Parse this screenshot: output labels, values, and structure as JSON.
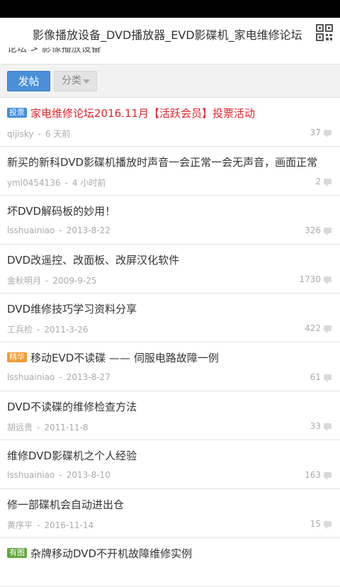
{
  "header": {
    "title": "影像播放设备_DVD播放器_EVD影碟机_家电维修论坛",
    "qr_icon": "qr-code-icon"
  },
  "breadcrumb": "论坛 > 影像播放设备",
  "toolbar": {
    "post_label": "发帖",
    "category_label": "分类"
  },
  "threads": [
    {
      "tag": "投票",
      "tag_type": "vote",
      "title": "家电维修论坛2016.11月【活跃会员】投票活动",
      "highlight": true,
      "author": "qijisky",
      "time": "6 天前",
      "replies": "37"
    },
    {
      "tag": "",
      "tag_type": "",
      "title": "新买的新科DVD影碟机播放时声音一会正常一会无声音，画面正常",
      "highlight": false,
      "author": "yml0454136",
      "time": "4 小时前",
      "replies": "2"
    },
    {
      "tag": "",
      "tag_type": "",
      "title": "坏DVD解码板的妙用！",
      "highlight": false,
      "author": "lsshuainiao",
      "time": "2013-8-22",
      "replies": "326"
    },
    {
      "tag": "",
      "tag_type": "",
      "title": "DVD改遥控、改面板、改屏汉化软件",
      "highlight": false,
      "author": "金秋明月",
      "time": "2009-9-25",
      "replies": "1730"
    },
    {
      "tag": "",
      "tag_type": "",
      "title": "DVD维修技巧学习资料分享",
      "highlight": false,
      "author": "工兵检",
      "time": "2011-3-26",
      "replies": "422"
    },
    {
      "tag": "精华",
      "tag_type": "elite",
      "title": "移动EVD不读碟 —— 伺服电路故障一例",
      "highlight": false,
      "author": "lsshuainiao",
      "time": "2013-8-27",
      "replies": "61"
    },
    {
      "tag": "",
      "tag_type": "",
      "title": "DVD不读碟的维修检查方法",
      "highlight": false,
      "author": "胡远贵",
      "time": "2011-11-8",
      "replies": "33"
    },
    {
      "tag": "",
      "tag_type": "",
      "title": "维修DVD影碟机之个人经验",
      "highlight": false,
      "author": "lsshuainiao",
      "time": "2013-8-10",
      "replies": "163"
    },
    {
      "tag": "",
      "tag_type": "",
      "title": "修一部碟机会自动进出仓",
      "highlight": false,
      "author": "黄序平",
      "time": "2016-11-14",
      "replies": "15"
    },
    {
      "tag": "有图",
      "tag_type": "pic",
      "title": "杂牌移动DVD不开机故障维修实例",
      "highlight": false,
      "author": "",
      "time": "",
      "replies": ""
    }
  ]
}
